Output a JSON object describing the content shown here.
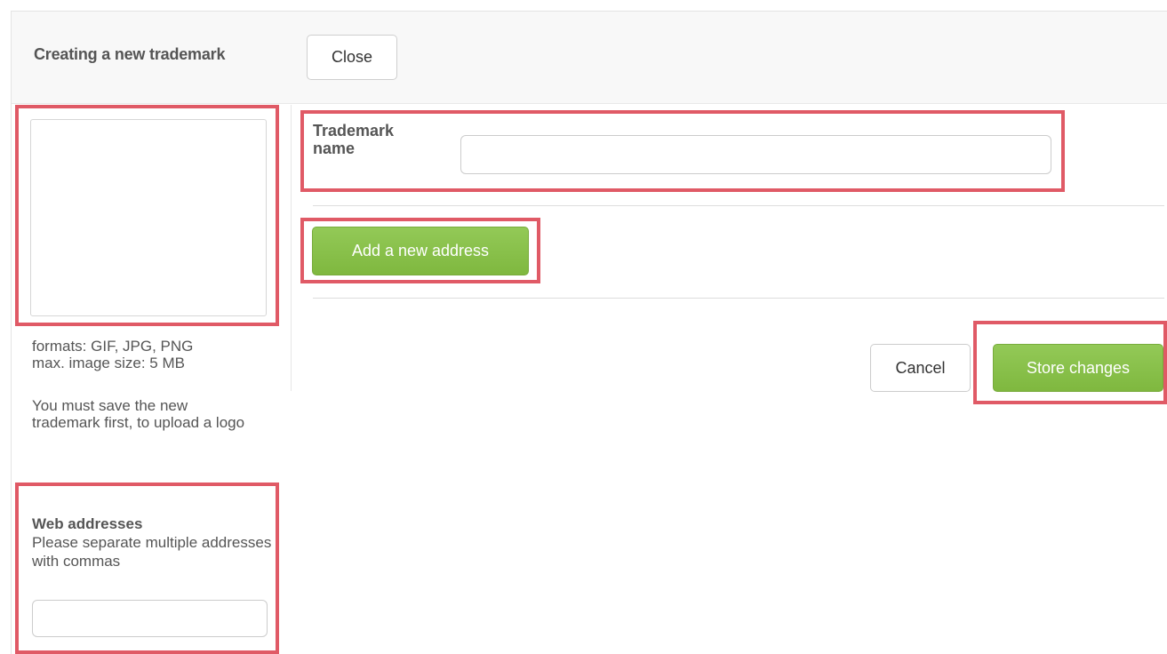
{
  "header": {
    "title": "Creating a new trademark",
    "close_label": "Close"
  },
  "logo_panel": {
    "formats_line1": "formats: GIF, JPG, PNG",
    "formats_line2": "max. image size: 5 MB",
    "save_first_note": "You must save the new trademark first, to upload a logo"
  },
  "web_addresses": {
    "title": "Web addresses",
    "hint": "Please separate multiple addresses with commas",
    "value": ""
  },
  "trademark_name": {
    "label": "Trademark name",
    "value": ""
  },
  "actions": {
    "add_address_label": "Add a new address",
    "cancel_label": "Cancel",
    "store_label": "Store changes"
  },
  "colors": {
    "primary_green": "#8bc34a",
    "highlight_red": "#e05a66"
  }
}
